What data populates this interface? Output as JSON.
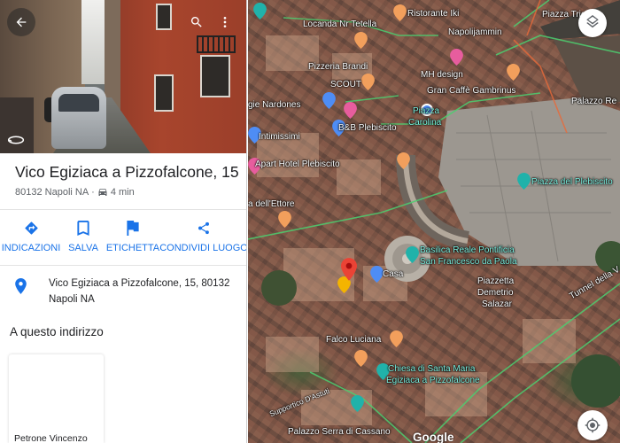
{
  "panel": {
    "title": "Vico Egiziaca a Pizzofalcone, 15",
    "postal": "80132 Napoli NA",
    "drive_time": "4 min",
    "separator": "·",
    "actions": {
      "directions": "INDICAZIONI",
      "save": "SALVA",
      "label": "ETICHETTA",
      "share": "CONDIVIDI LUOGO"
    },
    "full_address_line1": "Vico Egiziaca a Pizzofalcone, 15, 80132",
    "full_address_line2": "Napoli NA",
    "section_title": "A questo indirizzo",
    "card_name": "Petrone Vincenzo"
  },
  "map": {
    "labels": {
      "locanda": "Locanda Nr Tetella",
      "ristorante": "Ristorante Iki",
      "piazza_trieste": "Piazza Tries",
      "napolijammin": "Napolijammin",
      "pizzeria_brandi": "Pizzeria Brandi",
      "mh_design": "MH design",
      "scout": "SCOUT",
      "gran_caffe": "Gran Caffè Gambrinus",
      "palazzo_reale": "Palazzo Re",
      "nardones": "gie Nardones",
      "piazza_carolina_1": "Piazza",
      "piazza_carolina_2": "Carolina",
      "intimissimi": "Intimissimi",
      "bb_plebiscito": "B&B Plebiscito",
      "apart_hotel": "Apart Hotel Plebiscito",
      "piazza_plebiscito": "Piazza del Plebiscito",
      "ettore": "a dell'Ettore",
      "basilica_1": "Basilica Reale Pontificia",
      "basilica_2": "San Francesco da Paola",
      "casa": "Casa",
      "piazzetta_1": "Piazzetta",
      "piazzetta_2": "Demetrio",
      "piazzetta_3": "Salazar",
      "tunnel": "Tunnel della V",
      "falco": "Falco Luciana",
      "chiesa_1": "Chiesa di Santa Maria",
      "chiesa_2": "Egiziaca a Pizzofalcone",
      "supportico": "Supportico D'Astuti",
      "palazzo_serra": "Palazzo Serra di Cassano",
      "google": "Google"
    }
  },
  "icons": {
    "back": "arrow-left-icon",
    "search": "search-icon",
    "more": "more-vert-icon",
    "layers": "layers-icon",
    "locate": "my-location-icon"
  },
  "colors": {
    "accent": "#1a73e8",
    "pin_red": "#ea4335",
    "poi_orange": "#f29f5c",
    "poi_pink": "#e75d9e",
    "poi_blue": "#4e8df5",
    "poi_teal": "#20b2aa",
    "road_green": "#4ccf70"
  }
}
